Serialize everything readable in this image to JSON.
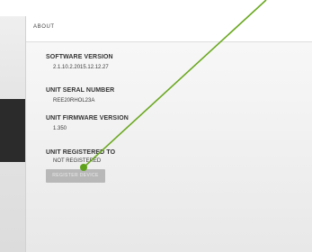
{
  "header": {
    "title": "ABOUT"
  },
  "about": {
    "software_version_label": "SOFTWARE VERSION",
    "software_version_value": "2.1.10.2.2015.12.12.27",
    "serial_label": "UNIT SERAL NUMBER",
    "serial_value": "REE20RHOL23A",
    "firmware_label": "UNIT FIRMWARE VERSION",
    "firmware_value": "1.350",
    "registered_label": "UNIT REGISTERED TO",
    "registered_value": "NOT REGISTERED"
  },
  "actions": {
    "register_label": "REGISTER DEVICE"
  },
  "colors": {
    "annotation_line": "#6aa81f",
    "annotation_dot": "#5ea21c",
    "button": "#b8b8b8",
    "sidebar_dark": "#2b2b2b"
  }
}
